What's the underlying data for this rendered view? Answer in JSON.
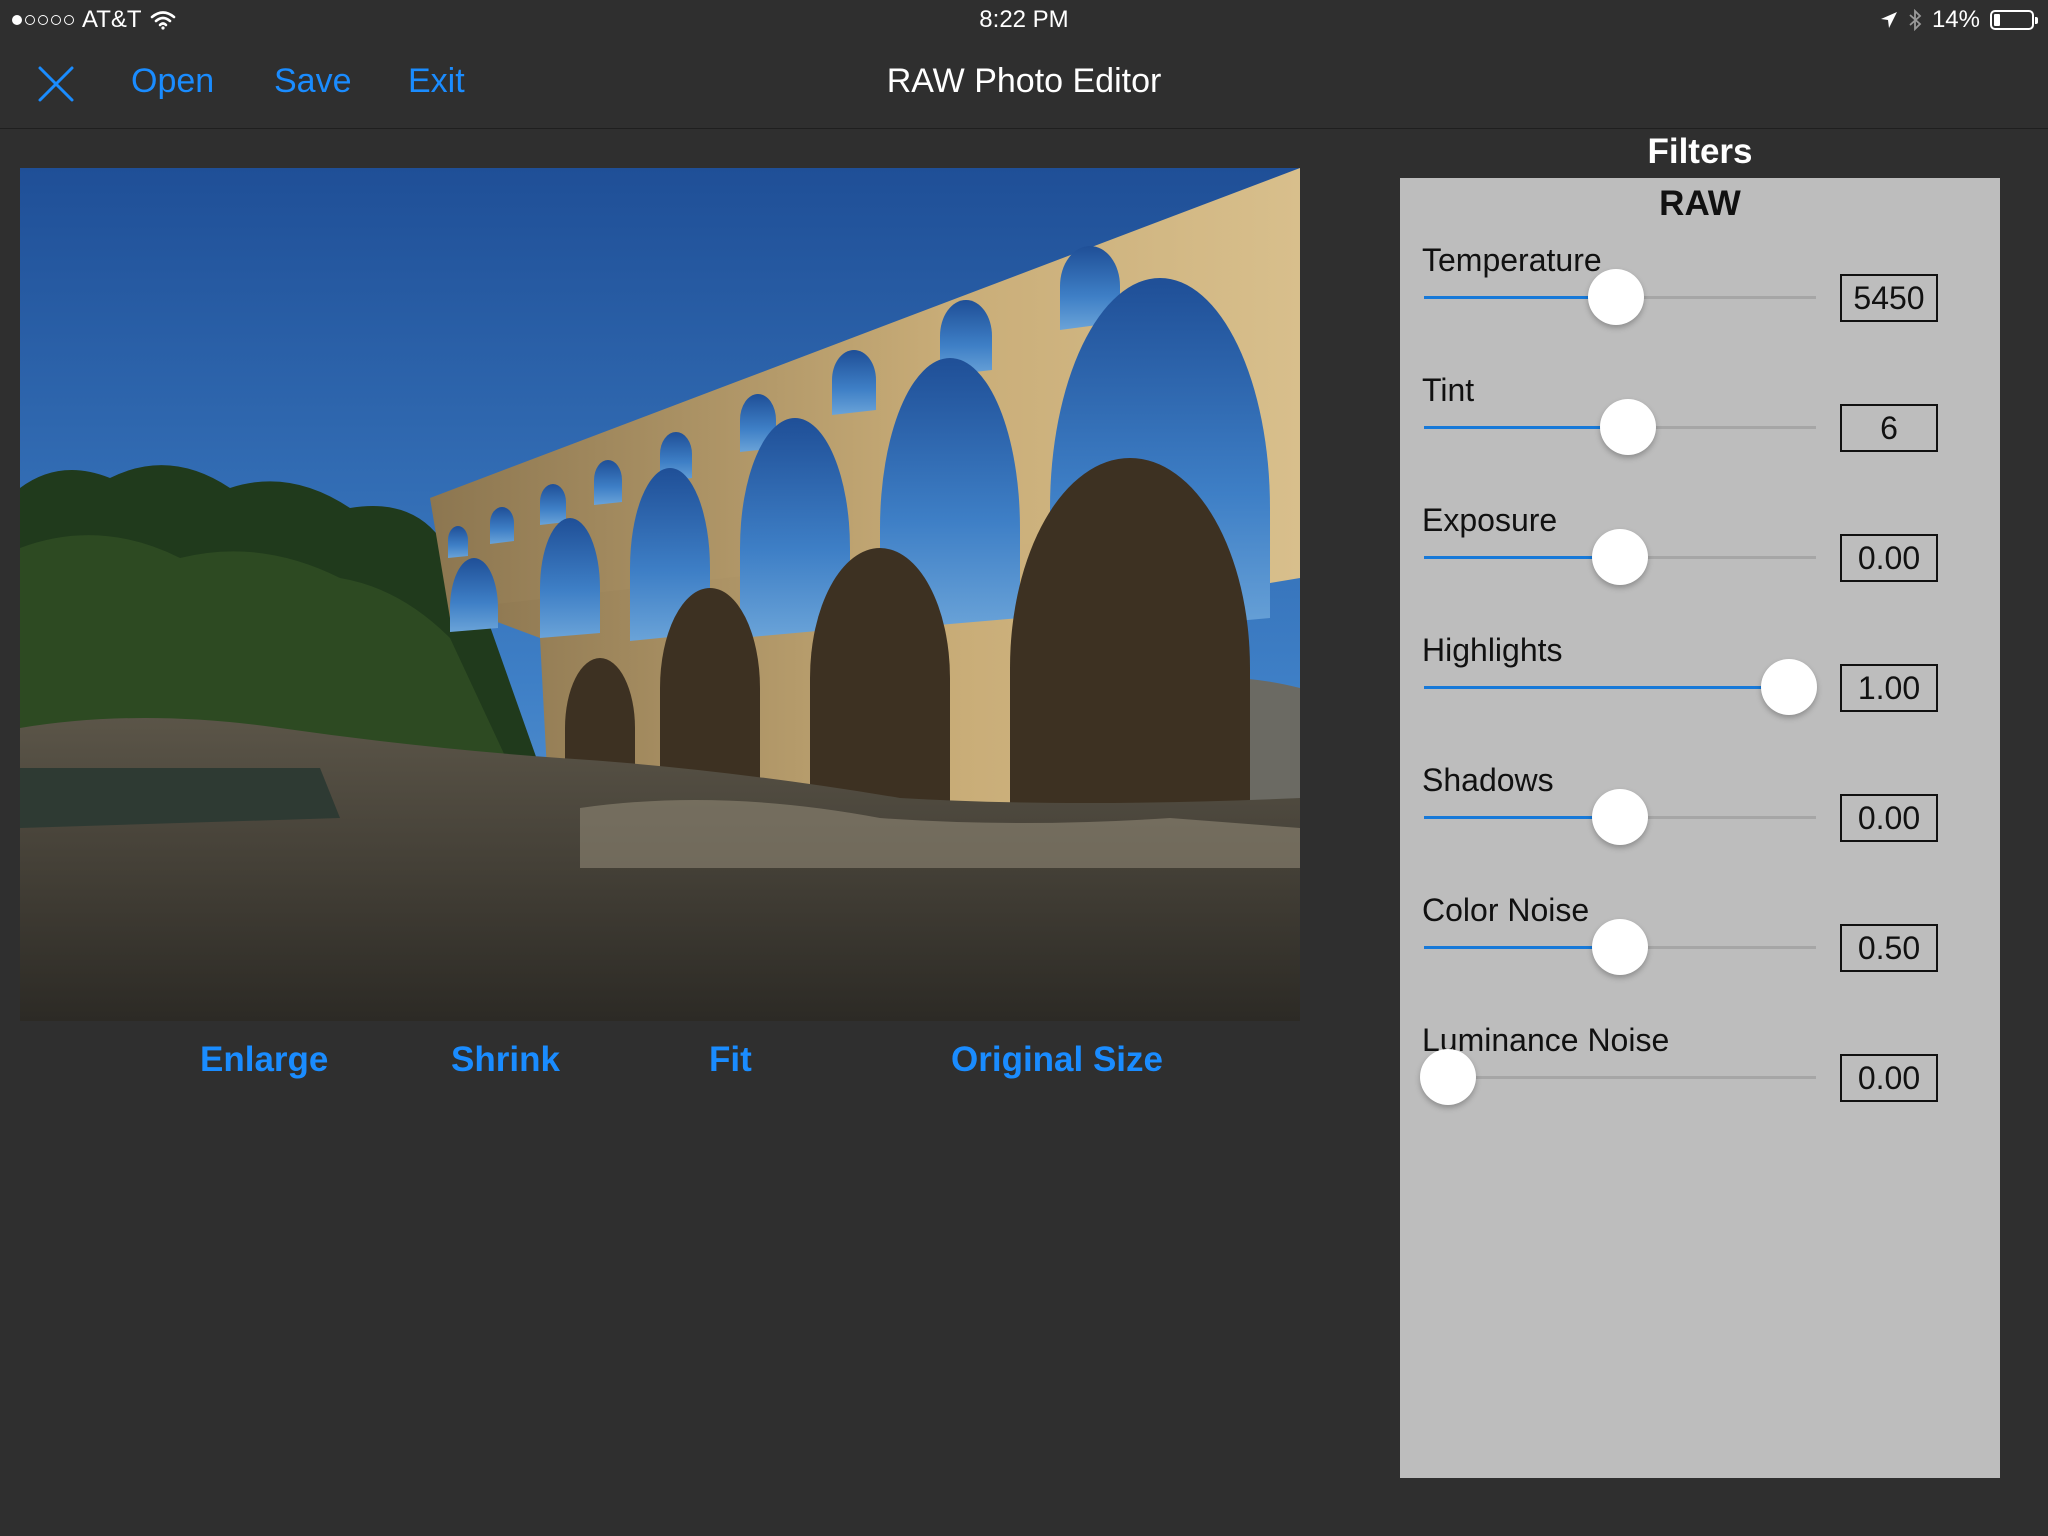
{
  "status_bar": {
    "carrier": "AT&T",
    "signal_dots_filled": 1,
    "signal_dots_total": 5,
    "time": "8:22 PM",
    "battery_percent": "14%"
  },
  "navbar": {
    "open_label": "Open",
    "save_label": "Save",
    "exit_label": "Exit",
    "title": "RAW Photo Editor"
  },
  "image_controls": {
    "enlarge_label": "Enlarge",
    "shrink_label": "Shrink",
    "fit_label": "Fit",
    "original_label": "Original Size"
  },
  "filters": {
    "title": "Filters",
    "section": "RAW",
    "items": [
      {
        "label": "Temperature",
        "value": "5450",
        "slider_fraction": 0.49
      },
      {
        "label": "Tint",
        "value": "6",
        "slider_fraction": 0.52
      },
      {
        "label": "Exposure",
        "value": "0.00",
        "slider_fraction": 0.5
      },
      {
        "label": "Highlights",
        "value": "1.00",
        "slider_fraction": 0.93
      },
      {
        "label": "Shadows",
        "value": "0.00",
        "slider_fraction": 0.5
      },
      {
        "label": "Color Noise",
        "value": "0.50",
        "slider_fraction": 0.5
      },
      {
        "label": "Luminance Noise",
        "value": "0.00",
        "slider_fraction": 0.06
      }
    ]
  },
  "colors": {
    "accent": "#1a8cff",
    "background": "#2f2f2f",
    "panel": "#bdbdbd",
    "slider_fill": "#1779d8"
  }
}
